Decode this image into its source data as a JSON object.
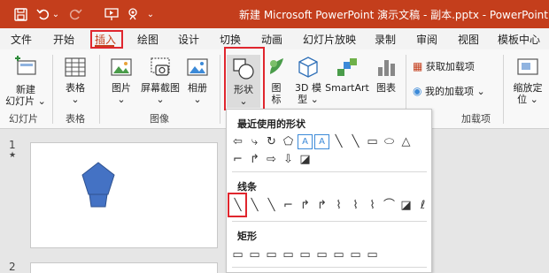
{
  "titlebar": {
    "title": "新建 Microsoft PowerPoint 演示文稿 - 副本.pptx  -  PowerPoint",
    "qat": [
      {
        "name": "save-icon",
        "glyph": "🖫"
      },
      {
        "name": "undo-icon",
        "glyph": "↶"
      },
      {
        "name": "undo-dropdown-icon",
        "glyph": "⌄"
      },
      {
        "name": "redo-icon",
        "glyph": "↻"
      },
      {
        "name": "present-icon",
        "glyph": "⛋"
      },
      {
        "name": "touch-mode-icon",
        "glyph": "⚇"
      },
      {
        "name": "customize-qat-icon",
        "glyph": "⌄"
      }
    ]
  },
  "tabs": [
    "文件",
    "开始",
    "插入",
    "绘图",
    "设计",
    "切换",
    "动画",
    "幻灯片放映",
    "录制",
    "审阅",
    "视图",
    "模板中心"
  ],
  "active_tab": "插入",
  "ribbon": {
    "new_slide": {
      "line1": "新建",
      "line2": "幻灯片 ⌄"
    },
    "table": {
      "line1": "表格",
      "line2": "⌄"
    },
    "picture": {
      "line1": "图片",
      "line2": "⌄"
    },
    "screenshot": {
      "line1": "屏幕截图",
      "line2": "⌄"
    },
    "album": {
      "line1": "相册",
      "line2": "⌄"
    },
    "shapes": {
      "line1": "形状",
      "line2": "⌄"
    },
    "icons": {
      "line1": "图",
      "line2": "标"
    },
    "models3d": {
      "line1": "3D 模",
      "line2": "型 ⌄"
    },
    "smartart": {
      "line1": "SmartArt"
    },
    "chart": {
      "line1": "图表"
    },
    "get_addins": "获取加载项",
    "my_addins": "我的加载项 ⌄",
    "zoom": {
      "line1": "缩放定",
      "line2": "位 ⌄"
    },
    "groups": {
      "slides": "幻灯片",
      "tables": "表格",
      "images": "图像",
      "addins": "加载项"
    }
  },
  "slides_pane": {
    "slide1": {
      "number": "1",
      "star": "★"
    },
    "slide2": {
      "number": "2"
    }
  },
  "shapes_menu": {
    "recent": "最近使用的形状",
    "lines": "线条",
    "rectangles": "矩形",
    "recent_row1": [
      "⇦",
      "⤷",
      "↻",
      "⬠",
      "A",
      "A",
      "╲",
      "╲",
      "▭",
      "⬭",
      "△"
    ],
    "recent_row2": [
      "⌐",
      "↱",
      "⇨",
      "⇩",
      "◪"
    ],
    "lines_row": [
      "╲",
      "╲",
      "╲",
      "⌐",
      "↱",
      "↱",
      "⌇",
      "⌇",
      "⌇",
      "⌒",
      "◪",
      "ℓ"
    ],
    "rect_row": [
      "▭",
      "▭",
      "▭",
      "▭",
      "▭",
      "▭",
      "▭",
      "▭",
      "▭"
    ]
  },
  "colors": {
    "accent": "#c43e1c",
    "highlight": "#e0262e",
    "shape_fill": "#4472c4"
  }
}
